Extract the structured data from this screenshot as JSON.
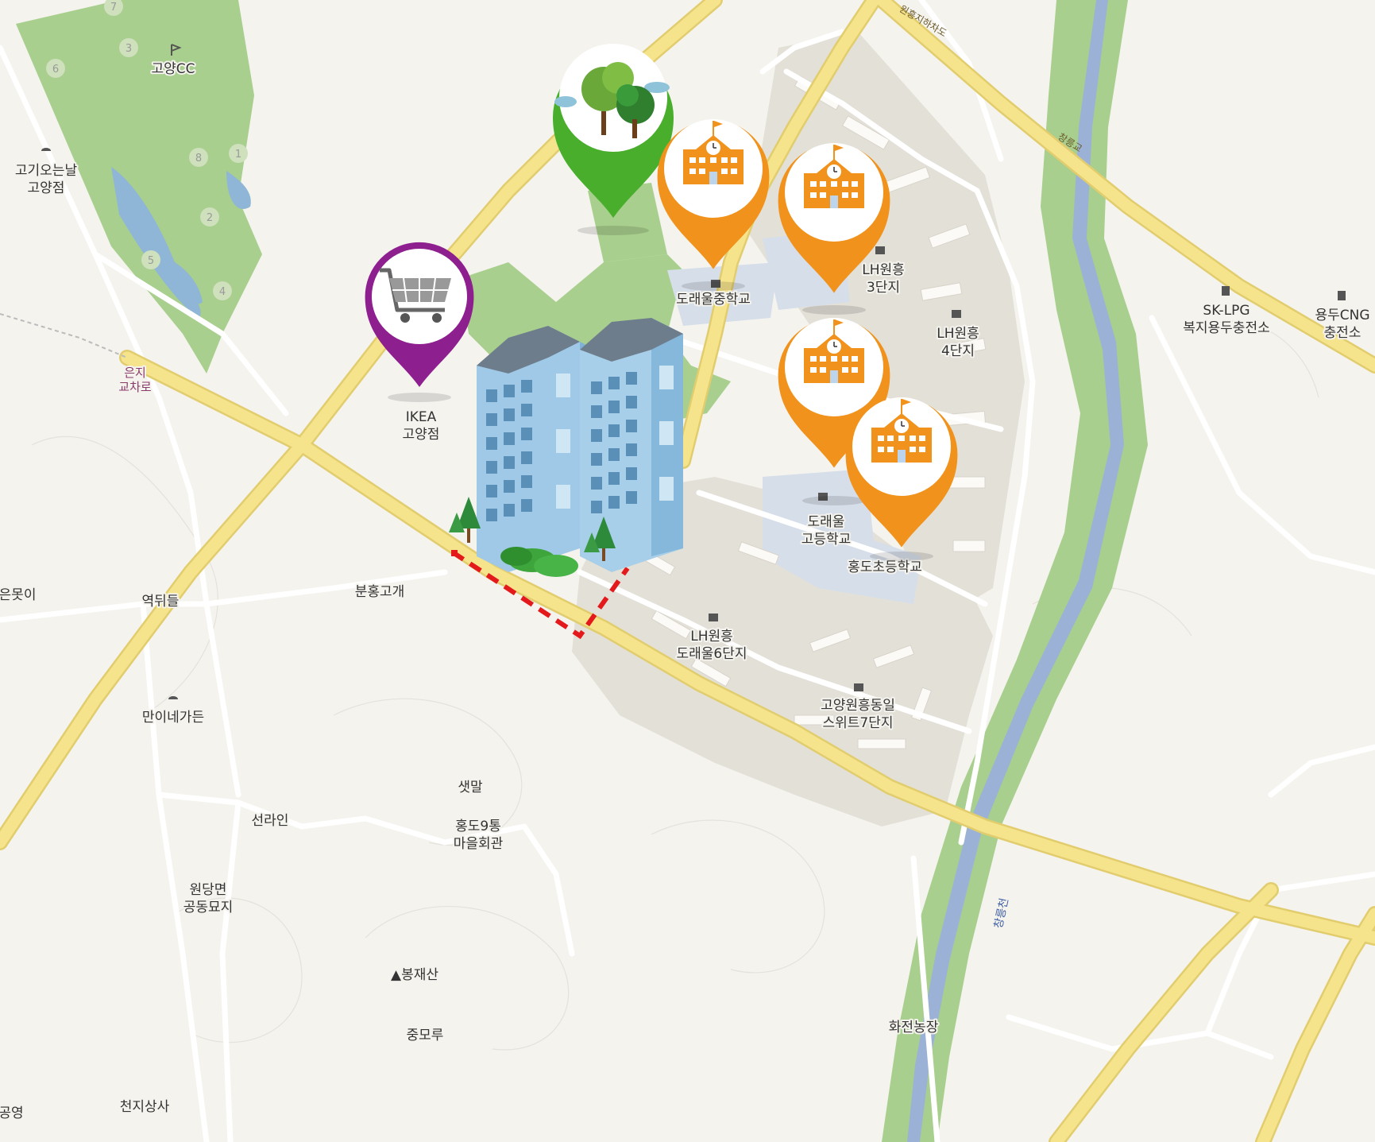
{
  "labels": {
    "golf": "고양CC",
    "bbq": "고기오는날\n고양점",
    "ikea": "IKEA\n고양점",
    "middle_school": "도래울중학교",
    "apt3": "LH원흥\n3단지",
    "apt4": "LH원흥\n4단지",
    "high_school": "도래울\n고등학교",
    "elementary": "홍도초등학교",
    "apt6": "LH원흥\n도래울6단지",
    "suite7": "고양원흥동일\n스위트7단지",
    "interchange": "은지\n교차로",
    "eunmot": "은못이",
    "yeoktwi": "역뒤들",
    "bunhong": "분홍고개",
    "manine": "만이네가든",
    "saetmal": "샛말",
    "seonrain": "선라인",
    "hall": "홍도9통\n마을회관",
    "cemetery": "원당면\n공동묘지",
    "bongjae": "▲봉재산",
    "jungmoru": "중모루",
    "farm": "화전농장",
    "cheonji": "천지상사",
    "gongyeong": "공영",
    "lpg": "SK-LPG\n복지용두충전소",
    "cng": "용두CNG\n충전소",
    "underpass": "원흥지하차도",
    "bridge": "창릉교",
    "river": "창릉천"
  },
  "golf_holes": [
    "7",
    "3",
    "6",
    "8",
    "1",
    "2",
    "5",
    "4"
  ],
  "markers": [
    {
      "type": "shopping",
      "icon": "shopping-cart-icon",
      "color": "#8e1f8f"
    },
    {
      "type": "park",
      "icon": "trees-icon",
      "color": "#4aae2d"
    },
    {
      "type": "school",
      "icon": "school-icon",
      "color": "#f0921b"
    },
    {
      "type": "school",
      "icon": "school-icon",
      "color": "#f0921b"
    },
    {
      "type": "school",
      "icon": "school-icon",
      "color": "#f0921b"
    },
    {
      "type": "school",
      "icon": "school-icon",
      "color": "#f0921b"
    }
  ],
  "colors": {
    "map_bg": "#f4f3ee",
    "major_road": "#f6e48d",
    "minor_road": "#ffffff",
    "green_area": "#a8cf8d",
    "river": "#9bb2d6",
    "school_zone": "#d6deea",
    "apartment_zone": "#e3e0d8",
    "site_boundary": "#e3191c"
  }
}
